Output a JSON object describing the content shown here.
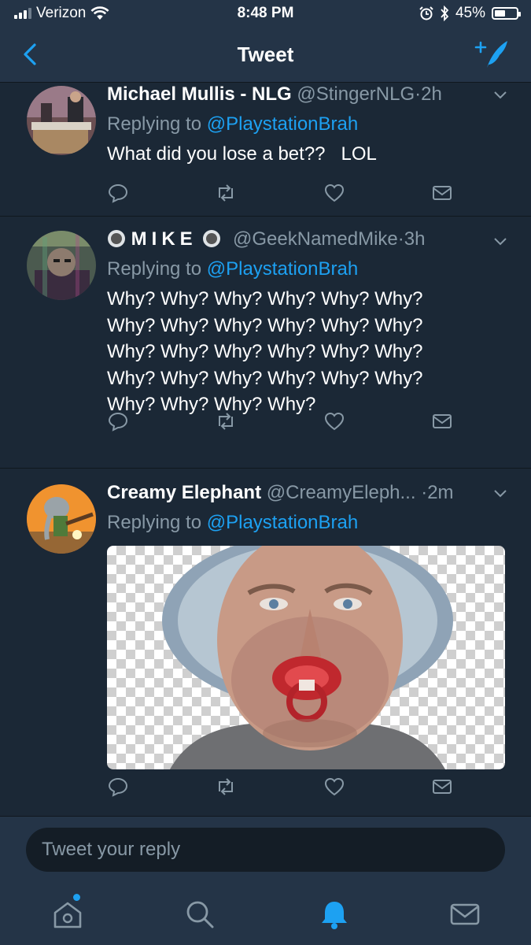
{
  "status_bar": {
    "carrier": "Verizon",
    "time": "8:48 PM",
    "battery": "45%",
    "battery_level": 0.45
  },
  "nav": {
    "title": "Tweet"
  },
  "tweets": [
    {
      "name": "Michael Mullis - NLG",
      "handle": "@StingerNLG",
      "separator": "·",
      "time": "2h",
      "replying_prefix": "Replying to",
      "replying_to": "@PlaystationBrah",
      "text": "What did you lose a bet??   LOL"
    },
    {
      "name": "MIKE",
      "handle": "@GeekNamedMike",
      "separator": "·",
      "time": "3h",
      "replying_prefix": "Replying to",
      "replying_to": "@PlaystationBrah",
      "text_lines": [
        "Why? Why? Why? Why? Why? Why?",
        "Why? Why? Why? Why? Why? Why?",
        "Why? Why? Why? Why? Why? Why?",
        "Why? Why? Why? Why? Why? Why?",
        "Why? Why? Why? Why?"
      ]
    },
    {
      "name": "Creamy Elephant",
      "handle": "@CreamyEleph...",
      "separator": "·",
      "time": "2m",
      "replying_prefix": "Replying to",
      "replying_to": "@PlaystationBrah"
    }
  ],
  "reply_bar": {
    "placeholder": "Tweet your reply"
  },
  "colors": {
    "accent": "#1da1f2",
    "background": "#141d26",
    "card": "#1b2836",
    "bar": "#243447",
    "secondary_text": "#8899a6"
  },
  "icons": {
    "back": "chevron-left-icon",
    "compose": "compose-feather-icon",
    "reply": "reply-bubble-icon",
    "retweet": "retweet-icon",
    "like": "heart-icon",
    "message": "envelope-icon",
    "more": "chevron-down-icon",
    "tabs": [
      "home-icon",
      "search-icon",
      "notifications-bell-icon",
      "messages-envelope-icon"
    ]
  }
}
